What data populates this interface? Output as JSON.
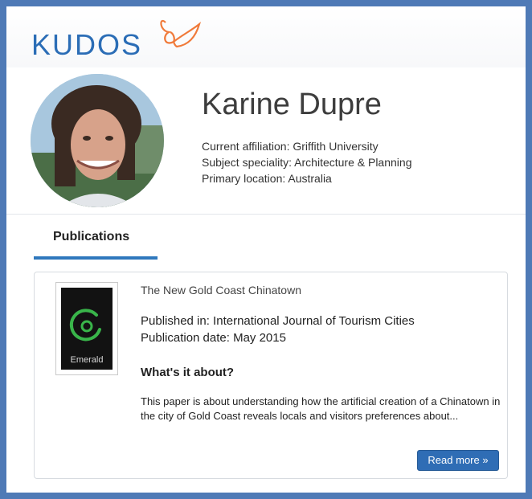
{
  "brand": {
    "logo_text": "KUDOS",
    "logo_color": "#2b6db6",
    "accent_color": "#f07a3a"
  },
  "profile": {
    "name": "Karine Dupre",
    "affiliation": "Current affiliation: Griffith University",
    "speciality": "Subject speciality: Architecture & Planning",
    "location": "Primary location: Australia",
    "avatar_icon": "avatar-photo"
  },
  "tabs": [
    {
      "label": "Publications",
      "active": true
    }
  ],
  "publication": {
    "title": "The New Gold Coast Chinatown",
    "published_in": "Published in: International Journal of Tourism Cities",
    "publication_date": "Publication date: May 2015",
    "about_heading": "What's it about?",
    "about_text": "This paper is about understanding how the artificial creation of a Chinatown in the city of Gold Coast reveals locals and visitors preferences about...",
    "cover_label": "Emerald",
    "read_more_label": "Read more »"
  }
}
